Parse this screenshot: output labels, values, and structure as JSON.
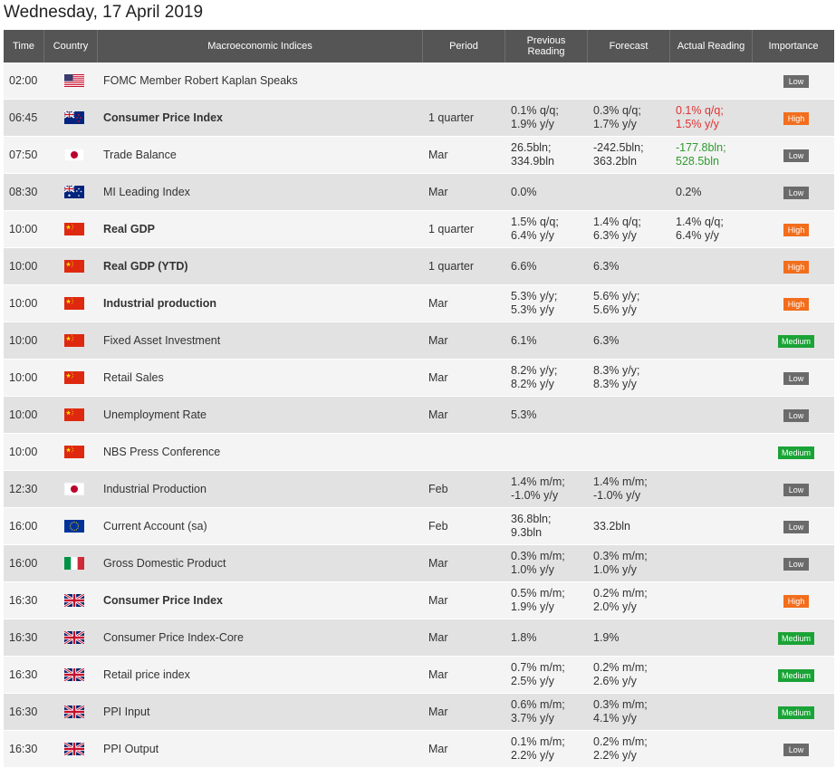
{
  "page_title": "Wednesday, 17 April 2019",
  "columns": {
    "time": "Time",
    "country": "Country",
    "event": "Macroeconomic Indices",
    "period": "Period",
    "previous": "Previous\nReading",
    "forecast": "Forecast",
    "actual": "Actual Reading",
    "importance": "Importance"
  },
  "colors": {
    "low": "#6b6b6b",
    "high": "#f26e1c",
    "medium": "#1aa336",
    "negative": "#e03232",
    "positive": "#2f9a2f",
    "header": "#555555"
  },
  "rows": [
    {
      "time": "02:00",
      "flag": "us-flag-icon",
      "event": "FOMC Member Robert Kaplan Speaks",
      "bold": false,
      "period": "",
      "previous": "",
      "forecast": "",
      "actual": "",
      "actual_tone": "",
      "importance": "Low"
    },
    {
      "time": "06:45",
      "flag": "nz-flag-icon",
      "event": "Consumer Price Index",
      "bold": true,
      "period": "1 quarter",
      "previous": "0.1% q/q;\n1.9% y/y",
      "forecast": "0.3% q/q;\n1.7% y/y",
      "actual": "0.1% q/q;\n1.5% y/y",
      "actual_tone": "neg",
      "importance": "High"
    },
    {
      "time": "07:50",
      "flag": "jp-flag-icon",
      "event": "Trade Balance",
      "bold": false,
      "period": "Mar",
      "previous": "26.5bln;\n334.9bln",
      "forecast": "-242.5bln;\n363.2bln",
      "actual": "-177.8bln;\n528.5bln",
      "actual_tone": "pos",
      "importance": "Low"
    },
    {
      "time": "08:30",
      "flag": "au-flag-icon",
      "event": "MI Leading Index",
      "bold": false,
      "period": "Mar",
      "previous": "0.0%",
      "forecast": "",
      "actual": "0.2%",
      "actual_tone": "",
      "importance": "Low"
    },
    {
      "time": "10:00",
      "flag": "cn-flag-icon",
      "event": "Real GDP",
      "bold": true,
      "period": "1 quarter",
      "previous": "1.5% q/q;\n6.4% y/y",
      "forecast": "1.4% q/q;\n6.3% y/y",
      "actual": "1.4% q/q;\n6.4% y/y",
      "actual_tone": "",
      "importance": "High"
    },
    {
      "time": "10:00",
      "flag": "cn-flag-icon",
      "event": "Real GDP (YTD)",
      "bold": true,
      "period": "1 quarter",
      "previous": "6.6%",
      "forecast": "6.3%",
      "actual": "",
      "actual_tone": "",
      "importance": "High"
    },
    {
      "time": "10:00",
      "flag": "cn-flag-icon",
      "event": "Industrial production",
      "bold": true,
      "period": "Mar",
      "previous": "5.3% y/y;\n5.3% y/y",
      "forecast": "5.6% y/y;\n5.6% y/y",
      "actual": "",
      "actual_tone": "",
      "importance": "High"
    },
    {
      "time": "10:00",
      "flag": "cn-flag-icon",
      "event": "Fixed Asset Investment",
      "bold": false,
      "period": "Mar",
      "previous": "6.1%",
      "forecast": "6.3%",
      "actual": "",
      "actual_tone": "",
      "importance": "Medium"
    },
    {
      "time": "10:00",
      "flag": "cn-flag-icon",
      "event": "Retail Sales",
      "bold": false,
      "period": "Mar",
      "previous": "8.2% y/y;\n8.2% y/y",
      "forecast": "8.3% y/y;\n8.3% y/y",
      "actual": "",
      "actual_tone": "",
      "importance": "Low"
    },
    {
      "time": "10:00",
      "flag": "cn-flag-icon",
      "event": "Unemployment Rate",
      "bold": false,
      "period": "Mar",
      "previous": "5.3%",
      "forecast": "",
      "actual": "",
      "actual_tone": "",
      "importance": "Low"
    },
    {
      "time": "10:00",
      "flag": "cn-flag-icon",
      "event": "NBS Press Conference",
      "bold": false,
      "period": "",
      "previous": "",
      "forecast": "",
      "actual": "",
      "actual_tone": "",
      "importance": "Medium"
    },
    {
      "time": "12:30",
      "flag": "jp-flag-icon",
      "event": "Industrial Production",
      "bold": false,
      "period": "Feb",
      "previous": "1.4% m/m;\n-1.0% y/y",
      "forecast": "1.4% m/m;\n-1.0% y/y",
      "actual": "",
      "actual_tone": "",
      "importance": "Low"
    },
    {
      "time": "16:00",
      "flag": "eu-flag-icon",
      "event": "Current Account (sa)",
      "bold": false,
      "period": "Feb",
      "previous": "36.8bln;\n9.3bln",
      "forecast": "33.2bln",
      "actual": "",
      "actual_tone": "",
      "importance": "Low"
    },
    {
      "time": "16:00",
      "flag": "it-flag-icon",
      "event": "Gross Domestic Product",
      "bold": false,
      "period": "Mar",
      "previous": "0.3% m/m;\n1.0% y/y",
      "forecast": "0.3% m/m;\n1.0% y/y",
      "actual": "",
      "actual_tone": "",
      "importance": "Low"
    },
    {
      "time": "16:30",
      "flag": "uk-flag-icon",
      "event": "Consumer Price Index",
      "bold": true,
      "period": "Mar",
      "previous": "0.5% m/m;\n1.9% y/y",
      "forecast": "0.2% m/m;\n2.0% y/y",
      "actual": "",
      "actual_tone": "",
      "importance": "High"
    },
    {
      "time": "16:30",
      "flag": "uk-flag-icon",
      "event": "Consumer Price Index-Core",
      "bold": false,
      "period": "Mar",
      "previous": "1.8%",
      "forecast": "1.9%",
      "actual": "",
      "actual_tone": "",
      "importance": "Medium"
    },
    {
      "time": "16:30",
      "flag": "uk-flag-icon",
      "event": "Retail price index",
      "bold": false,
      "period": "Mar",
      "previous": "0.7% m/m;\n2.5% y/y",
      "forecast": "0.2% m/m;\n2.6% y/y",
      "actual": "",
      "actual_tone": "",
      "importance": "Medium"
    },
    {
      "time": "16:30",
      "flag": "uk-flag-icon",
      "event": "PPI Input",
      "bold": false,
      "period": "Mar",
      "previous": "0.6% m/m;\n3.7% y/y",
      "forecast": "0.3% m/m;\n4.1% y/y",
      "actual": "",
      "actual_tone": "",
      "importance": "Medium"
    },
    {
      "time": "16:30",
      "flag": "uk-flag-icon",
      "event": "PPI Output",
      "bold": false,
      "period": "Mar",
      "previous": "0.1% m/m;\n2.2% y/y",
      "forecast": "0.2% m/m;\n2.2% y/y",
      "actual": "",
      "actual_tone": "",
      "importance": "Low"
    }
  ]
}
